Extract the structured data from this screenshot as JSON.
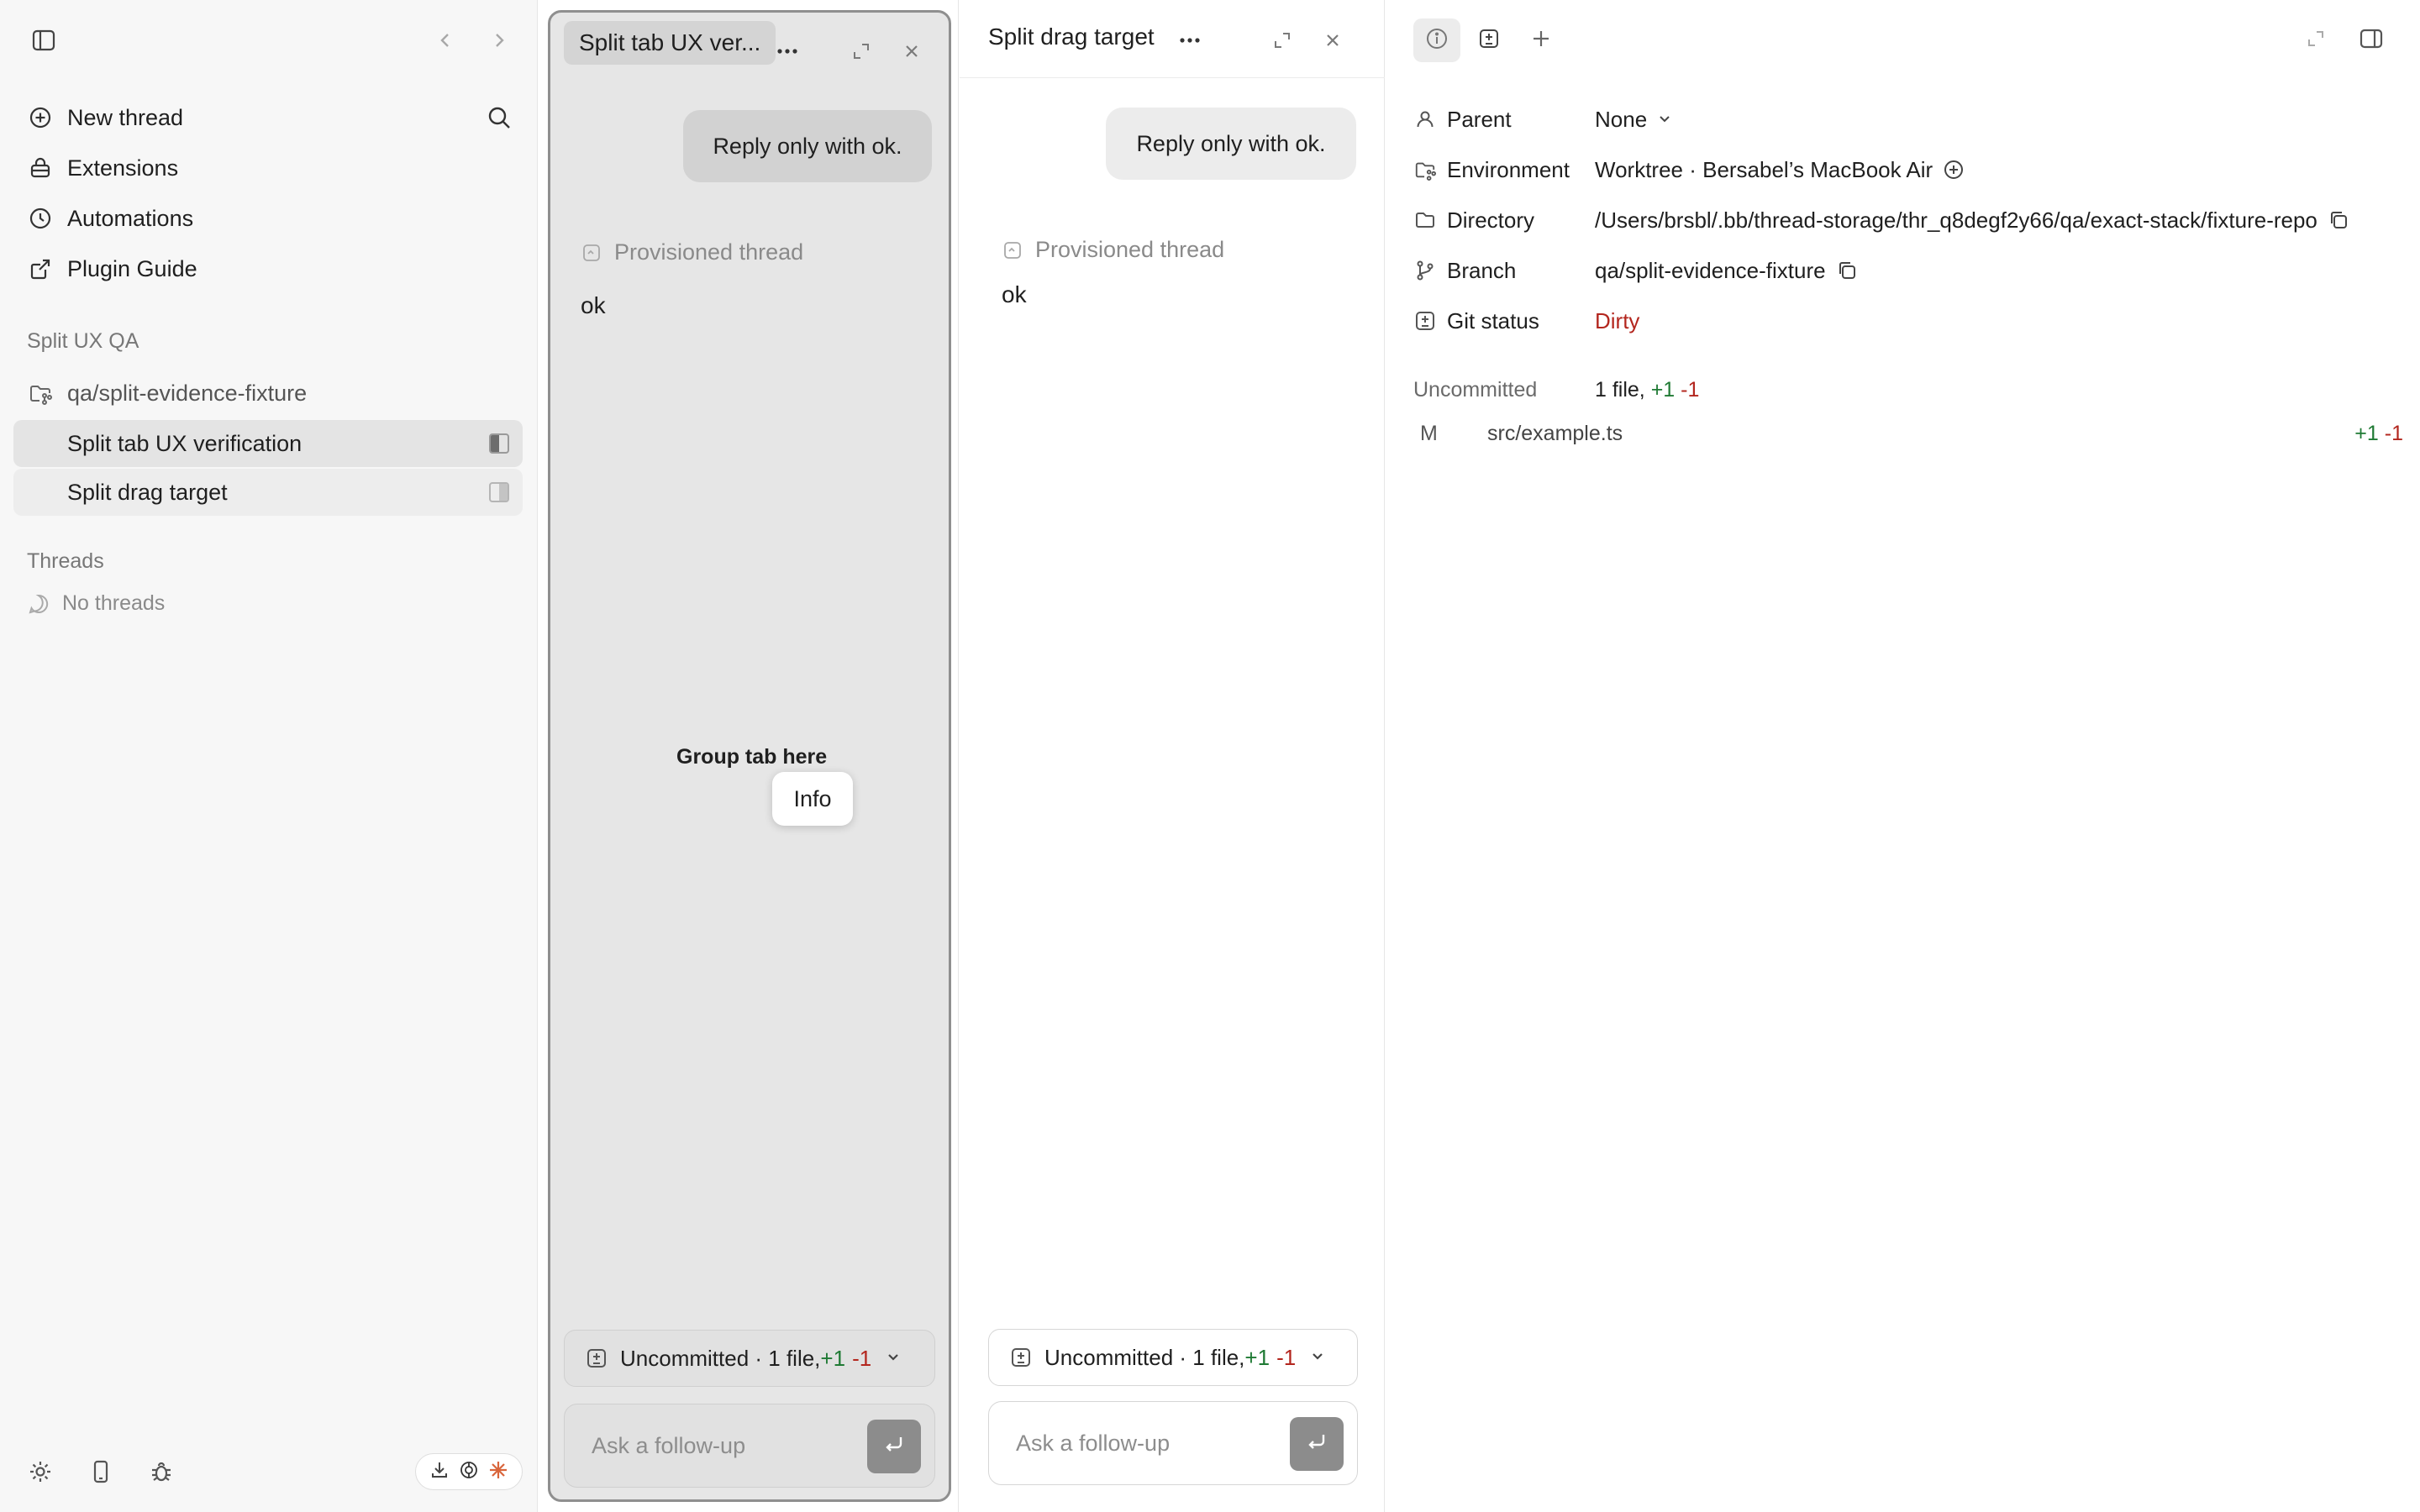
{
  "sidebar": {
    "nav": [
      {
        "label": "New thread",
        "icon": "plus-circle-icon"
      },
      {
        "label": "Extensions",
        "icon": "extensions-icon"
      },
      {
        "label": "Automations",
        "icon": "clock-icon"
      },
      {
        "label": "Plugin Guide",
        "icon": "external-link-icon"
      }
    ],
    "project_section": "Split UX QA",
    "project_name": "qa/split-evidence-fixture",
    "threads": [
      {
        "label": "Split tab UX verification",
        "active": true
      },
      {
        "label": "Split drag target",
        "active": false
      }
    ],
    "threads_section": "Threads",
    "no_threads": "No threads"
  },
  "pane_left": {
    "tab_title": "Split tab UX ver...",
    "user_message": "Reply only with ok.",
    "provisioned_label": "Provisioned thread",
    "reply": "ok",
    "drop_label": "Group tab here",
    "tooltip": "Info",
    "uncommitted": {
      "prefix": "Uncommitted · 1 file, ",
      "plus": "+1",
      "minus": "-1"
    },
    "composer_placeholder": "Ask a follow-up"
  },
  "pane_right": {
    "tab_title": "Split drag target",
    "user_message": "Reply only with ok.",
    "provisioned_label": "Provisioned thread",
    "reply": "ok",
    "uncommitted": {
      "prefix": "Uncommitted · 1 file, ",
      "plus": "+1",
      "minus": "-1"
    },
    "composer_placeholder": "Ask a follow-up"
  },
  "info": {
    "parent": {
      "label": "Parent",
      "value": "None"
    },
    "environment": {
      "label": "Environment",
      "value": "Worktree · Bersabel’s MacBook Air"
    },
    "directory": {
      "label": "Directory",
      "value": "/Users/brsbl/.bb/thread-storage/thr_q8degf2y66/qa/exact-stack/fixture-repo"
    },
    "branch": {
      "label": "Branch",
      "value": "qa/split-evidence-fixture"
    },
    "git_status": {
      "label": "Git status",
      "value": "Dirty"
    },
    "uncommitted_label": "Uncommitted",
    "uncommitted_summary": {
      "prefix": "1 file, ",
      "plus": "+1",
      "minus": "-1"
    },
    "files": [
      {
        "status": "M",
        "path": "src/example.ts",
        "plus": "+1",
        "minus": "-1"
      }
    ]
  },
  "colors": {
    "added": "#1f7a34",
    "removed": "#b3261e",
    "dirty": "#b3261e"
  }
}
